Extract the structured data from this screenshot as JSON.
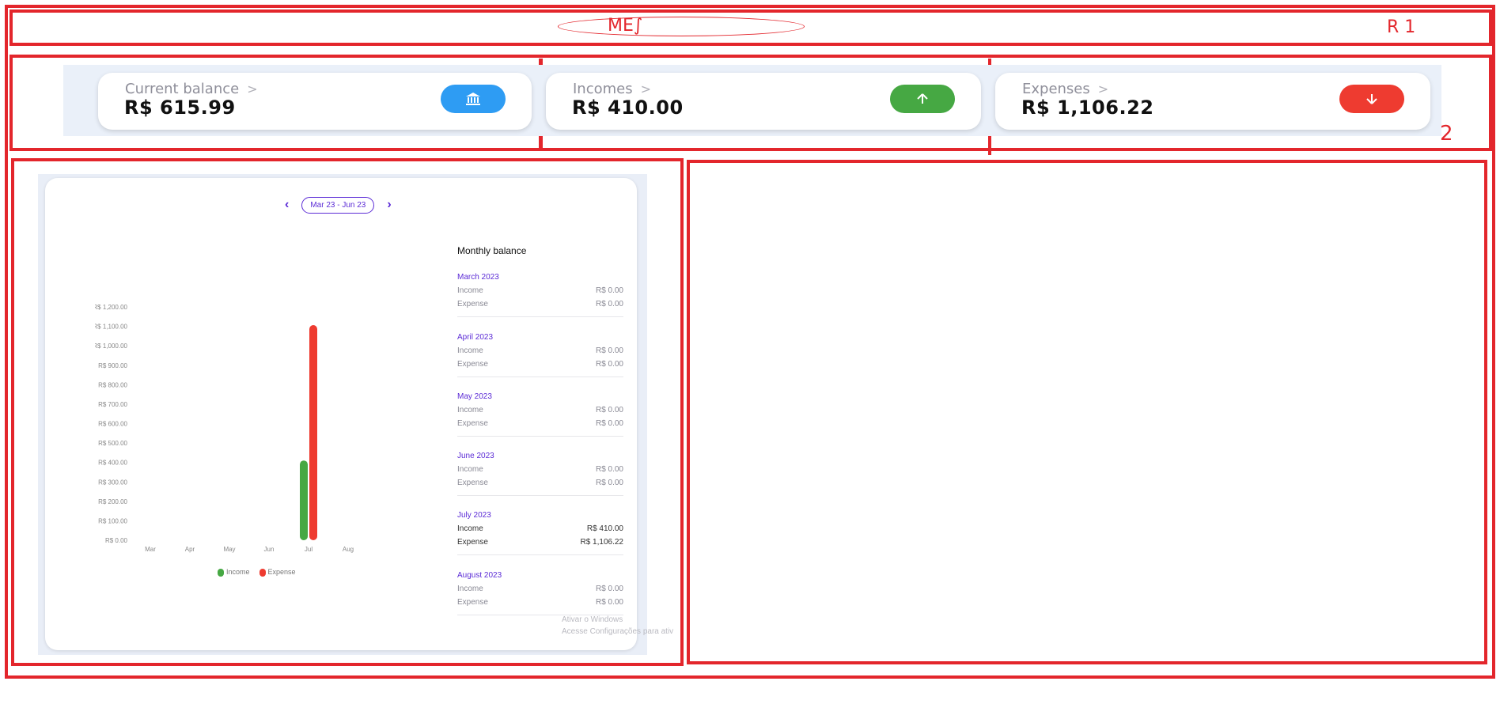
{
  "annotations": {
    "header_scribble": "ME∫",
    "label_r1": "R 1",
    "label_r2": "2"
  },
  "cards": [
    {
      "title": "Current balance",
      "arrow": ">",
      "amount": "R$ 615.99",
      "icon": "bank-icon",
      "color": "#2e9cf3"
    },
    {
      "title": "Incomes",
      "arrow": ">",
      "amount": "R$ 410.00",
      "icon": "arrow-up-icon",
      "color": "#46a843"
    },
    {
      "title": "Expenses",
      "arrow": ">",
      "amount": "R$ 1,106.22",
      "icon": "arrow-down-icon",
      "color": "#ee3b30"
    }
  ],
  "range": {
    "label": "Mar 23 - Jun 23",
    "prev": "‹",
    "next": "›"
  },
  "monthly": {
    "title": "Monthly balance",
    "months": [
      {
        "name": "March 2023",
        "income_label": "Income",
        "income": "R$ 0.00",
        "expense_label": "Expense",
        "expense": "R$ 0.00"
      },
      {
        "name": "April 2023",
        "income_label": "Income",
        "income": "R$ 0.00",
        "expense_label": "Expense",
        "expense": "R$ 0.00"
      },
      {
        "name": "May 2023",
        "income_label": "Income",
        "income": "R$ 0.00",
        "expense_label": "Expense",
        "expense": "R$ 0.00"
      },
      {
        "name": "June 2023",
        "income_label": "Income",
        "income": "R$ 0.00",
        "expense_label": "Expense",
        "expense": "R$ 0.00"
      },
      {
        "name": "July 2023",
        "income_label": "Income",
        "income": "R$ 410.00",
        "expense_label": "Expense",
        "expense": "R$ 1,106.22"
      },
      {
        "name": "August 2023",
        "income_label": "Income",
        "income": "R$ 0.00",
        "expense_label": "Expense",
        "expense": "R$ 0.00"
      }
    ]
  },
  "watermark": {
    "line1": "Ativar o Windows",
    "line2": "Acesse Configurações para ativ"
  },
  "chart_data": {
    "type": "bar",
    "categories": [
      "Mar",
      "Apr",
      "May",
      "Jun",
      "Jul",
      "Aug"
    ],
    "series": [
      {
        "name": "Income",
        "values": [
          0,
          0,
          0,
          0,
          410,
          0
        ],
        "color": "#46a843"
      },
      {
        "name": "Expense",
        "values": [
          0,
          0,
          0,
          0,
          1106.22,
          0
        ],
        "color": "#ee3b30"
      }
    ],
    "yticks": [
      "R$ 0.00",
      "R$ 100.00",
      "R$ 200.00",
      "R$ 300.00",
      "R$ 400.00",
      "R$ 500.00",
      "R$ 600.00",
      "R$ 700.00",
      "R$ 800.00",
      "R$ 900.00",
      "R$ 1,000.00",
      "R$ 1,100.00",
      "R$ 1,200.00"
    ],
    "ylim": [
      0,
      1200
    ],
    "legend": "bottom"
  }
}
